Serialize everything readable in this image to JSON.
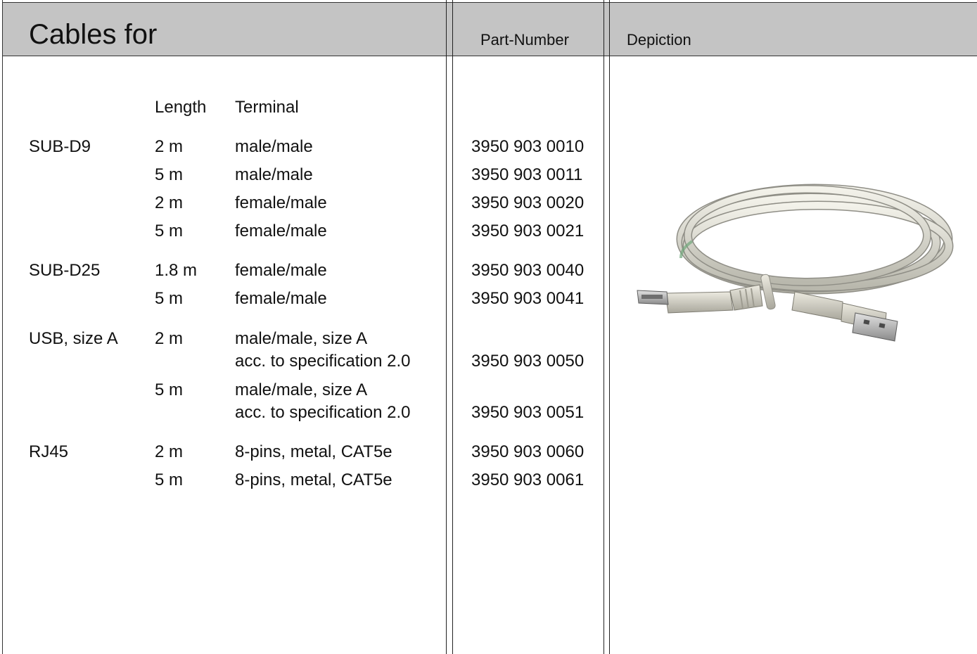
{
  "header": {
    "title": "Cables for",
    "part_number_label": "Part-Number",
    "depiction_label": "Depiction"
  },
  "columns": {
    "length": "Length",
    "terminal": "Terminal"
  },
  "groups": [
    {
      "name": "SUB-D9",
      "rows": [
        {
          "length": "2 m",
          "terminal": "male/male",
          "part_number": "3950 903 0010"
        },
        {
          "length": "5 m",
          "terminal": "male/male",
          "part_number": "3950 903 0011"
        },
        {
          "length": "2 m",
          "terminal": "female/male",
          "part_number": "3950 903 0020"
        },
        {
          "length": "5 m",
          "terminal": "female/male",
          "part_number": "3950 903 0021"
        }
      ]
    },
    {
      "name": "SUB-D25",
      "rows": [
        {
          "length": "1.8 m",
          "terminal": "female/male",
          "part_number": "3950 903 0040"
        },
        {
          "length": "5 m",
          "terminal": "female/male",
          "part_number": "3950 903 0041"
        }
      ]
    },
    {
      "name": "USB, size A",
      "rows": [
        {
          "length": "2 m",
          "terminal": "male/male, size A",
          "terminal_line2": "acc. to specification 2.0",
          "part_number": "3950 903 0050"
        },
        {
          "length": "5 m",
          "terminal": "male/male, size A",
          "terminal_line2": "acc. to specification 2.0",
          "part_number": "3950 903 0051"
        }
      ]
    },
    {
      "name": "RJ45",
      "rows": [
        {
          "length": "2 m",
          "terminal": "8-pins, metal, CAT5e",
          "part_number": "3950 903 0060"
        },
        {
          "length": "5 m",
          "terminal": "8-pins, metal, CAT5e",
          "part_number": "3950 903 0061"
        }
      ]
    }
  ],
  "depiction": {
    "icon": "usb-cable-photo"
  }
}
